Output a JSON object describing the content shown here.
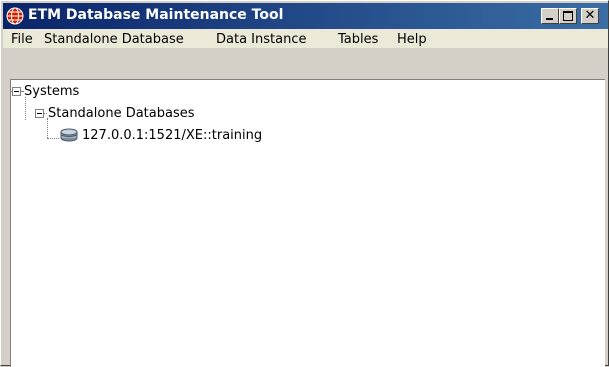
{
  "window": {
    "title": "ETM Database Maintenance Tool",
    "icon": "globe-icon",
    "controls": [
      "minimize-icon",
      "maximize-icon",
      "close-icon"
    ]
  },
  "menu": {
    "items": [
      {
        "label": "File"
      },
      {
        "label": "Standalone Database"
      },
      {
        "label": "Data Instance"
      },
      {
        "label": "Tables"
      },
      {
        "label": "Help"
      }
    ]
  },
  "tree": {
    "root": {
      "label": "Systems",
      "expanded": true,
      "children": [
        {
          "label": "Standalone Databases",
          "expanded": true,
          "children": [
            {
              "label": "127.0.0.1:1521/XE::training",
              "icon": "database-icon"
            }
          ]
        }
      ]
    }
  },
  "colors": {
    "titlebar_start": "#0a246a",
    "titlebar_end": "#3a6ea5",
    "app_icon": "#cc2200"
  }
}
